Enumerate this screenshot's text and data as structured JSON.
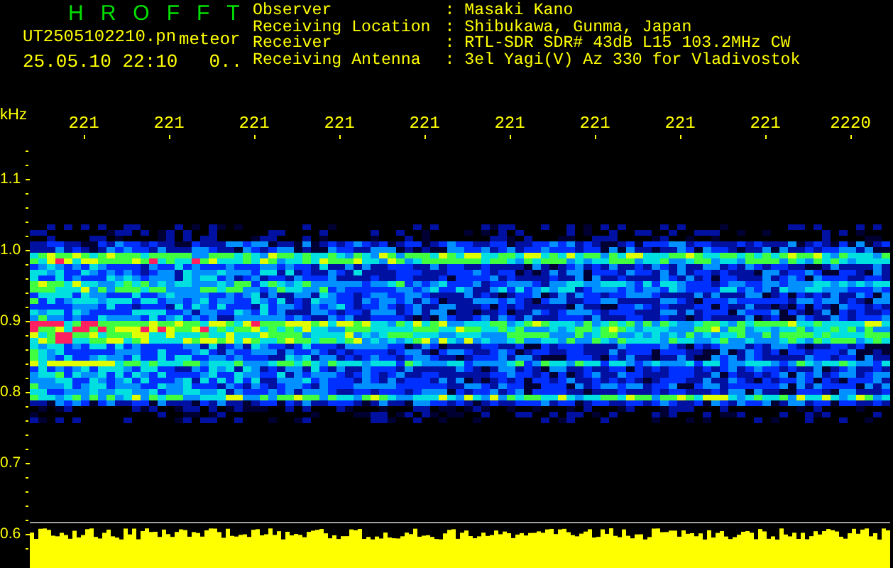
{
  "header": {
    "app_name": "HROFFT",
    "file_name": "UT2505102210.pn",
    "mode": "meteor",
    "timestamp": "25.05.10 22:10",
    "status": "0.."
  },
  "station_info": [
    {
      "label": "Observer",
      "value": ": Masaki Kano"
    },
    {
      "label": "Receiving Location",
      "value": ": Shibukawa, Gunma, Japan"
    },
    {
      "label": "Receiver",
      "value": ": RTL-SDR SDR# 43dB L15 103.2MHz CW"
    },
    {
      "label": "Receiving Antenna",
      "value": ": 3el Yagi(V) Az 330 for Vladivostok"
    }
  ],
  "y_axis": {
    "unit": "kHz",
    "labels": [
      "1.1",
      "1.0",
      "0.9",
      "0.8",
      "0.7",
      "0.6"
    ]
  },
  "time_labels": [
    "221",
    "221",
    "221",
    "221",
    "221",
    "221",
    "221",
    "221",
    "221",
    "2220"
  ]
}
